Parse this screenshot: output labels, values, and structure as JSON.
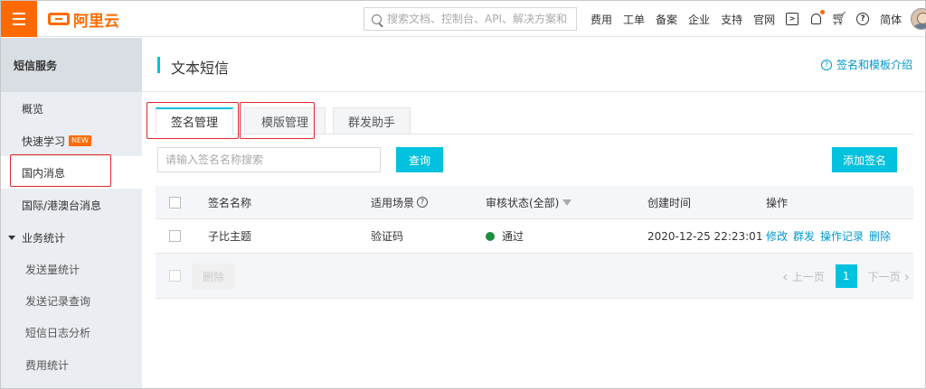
{
  "header": {
    "logo_text": "阿里云",
    "search_placeholder": "搜索文档、控制台、API、解决方案和资源",
    "nav": [
      "费用",
      "工单",
      "备案",
      "企业",
      "支持",
      "官网"
    ],
    "lang": "简体",
    "icons": [
      "terminal-icon",
      "bell-icon",
      "cart-icon",
      "help-icon"
    ],
    "accent_color": "#ff6a00"
  },
  "sidebar": {
    "title": "短信服务",
    "items": [
      {
        "label": "概览"
      },
      {
        "label": "快速学习",
        "badge": "NEW"
      },
      {
        "label": "国内消息"
      },
      {
        "label": "国际/港澳台消息"
      },
      {
        "label": "业务统计"
      },
      {
        "label": "发送量统计"
      },
      {
        "label": "发送记录查询"
      },
      {
        "label": "短信日志分析"
      },
      {
        "label": "费用统计"
      }
    ]
  },
  "main": {
    "title": "文本短信",
    "help_link": "签名和模板介绍",
    "tabs": [
      {
        "label": "签名管理",
        "active": true
      },
      {
        "label": "模版管理",
        "active": false
      },
      {
        "label": "群发助手",
        "active": false
      }
    ],
    "search_placeholder": "请输入签名名称搜索",
    "query_button": "查询",
    "add_button": "添加签名",
    "table": {
      "columns": [
        "签名名称",
        "适用场景",
        "审核状态(全部)",
        "创建时间",
        "操作"
      ],
      "rows": [
        {
          "name": "子比主题",
          "scene": "验证码",
          "status": "通过",
          "created": "2020-12-25 22:23:01",
          "actions": [
            "修改",
            "群发",
            "操作记录",
            "删除"
          ]
        }
      ]
    },
    "delete_button": "删除",
    "pager": {
      "prev": "上一页",
      "current": "1",
      "next": "下一页"
    },
    "primary_color": "#00c1de",
    "status_color": "#1e8e3e"
  }
}
